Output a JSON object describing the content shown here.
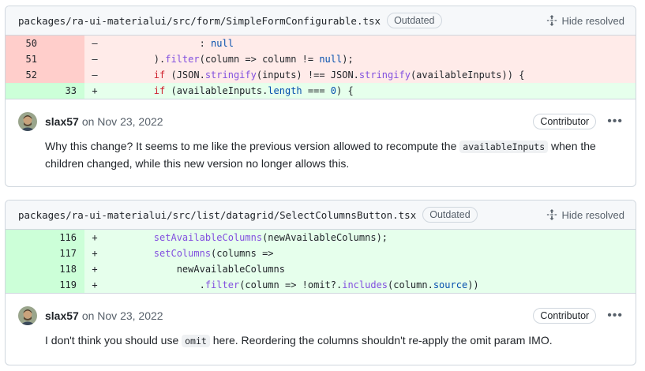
{
  "threads": [
    {
      "file_path": "packages/ra-ui-materialui/src/form/SimpleFormConfigurable.tsx",
      "status_badge": "Outdated",
      "hide_resolved_label": "Hide resolved",
      "comment": {
        "author": "slax57",
        "date": "on Nov 23, 2022",
        "role": "Contributor",
        "body_before": "Why this change? It seems to me like the previous version allowed to recompute the ",
        "body_code": "availableInputs",
        "body_after": " when the children changed, while this new version no longer allows this."
      }
    },
    {
      "file_path": "packages/ra-ui-materialui/src/list/datagrid/SelectColumnsButton.tsx",
      "status_badge": "Outdated",
      "hide_resolved_label": "Hide resolved",
      "comment": {
        "author": "slax57",
        "date": "on Nov 23, 2022",
        "role": "Contributor",
        "body_before": "I don't think you should use ",
        "body_code": "omit",
        "body_after": " here. Reordering the columns shouldn't re-apply the omit param IMO."
      }
    }
  ],
  "diff1": {
    "l50": {
      "old": "50",
      "new": "",
      "sign": "–"
    },
    "l51": {
      "old": "51",
      "new": "",
      "sign": "–"
    },
    "l52": {
      "old": "52",
      "new": "",
      "sign": "–"
    },
    "l33": {
      "old": "",
      "new": "33",
      "sign": "+"
    }
  },
  "diff2": {
    "l116": {
      "old": "",
      "new": "116",
      "sign": "+"
    },
    "l117": {
      "old": "",
      "new": "117",
      "sign": "+"
    },
    "l118": {
      "old": "",
      "new": "118",
      "sign": "+"
    },
    "l119": {
      "old": "",
      "new": "119",
      "sign": "+"
    }
  },
  "code": {
    "t1l1": {
      "indent": "                ",
      "p1": ": ",
      "null": "null"
    },
    "t1l2": {
      "indent": "        ",
      "p1": ").",
      "filter": "filter",
      "p2": "(column => column != ",
      "null": "null",
      "p3": ");"
    },
    "t1l3": {
      "indent": "        ",
      "if": "if",
      "p1": " (JSON.",
      "stringify1": "stringify",
      "p2": "(inputs) !== JSON.",
      "stringify2": "stringify",
      "p3": "(availableInputs)) {"
    },
    "t1l4": {
      "indent": "        ",
      "if": "if",
      "p1": " (availableInputs.",
      "length": "length",
      "p2": " === ",
      "zero": "0",
      "p3": ") {"
    },
    "t2l1": {
      "indent": "        ",
      "fn": "setAvailableColumns",
      "p1": "(newAvailableColumns);"
    },
    "t2l2": {
      "indent": "        ",
      "fn": "setColumns",
      "p1": "(columns =>"
    },
    "t2l3": {
      "indent": "            ",
      "p1": "newAvailableColumns"
    },
    "t2l4": {
      "indent": "                .",
      "filter": "filter",
      "p1": "(column => !omit?.",
      "includes": "includes",
      "p2": "(column.",
      "source": "source",
      "p3": "))"
    }
  },
  "colors": {
    "accent_del": "#ffebe9",
    "accent_add": "#e6ffec",
    "keyword": "#cf222e",
    "function": "#8250df"
  },
  "icons": {
    "hide_resolved": "fold-icon",
    "avatar": "avatar",
    "menu": "kebab-horizontal-icon"
  }
}
